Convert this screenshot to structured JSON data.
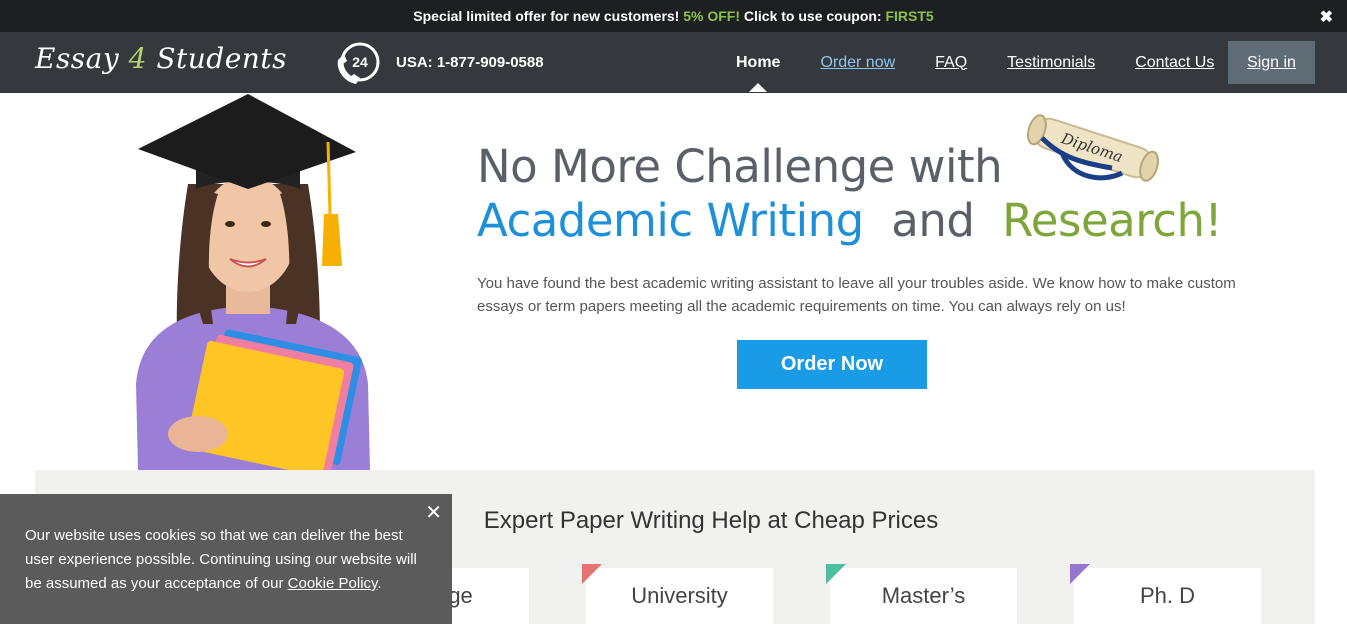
{
  "promo": {
    "text_before": "Special limited offer for new customers! ",
    "discount": "5% OFF!",
    "text_middle": " Click to use coupon: ",
    "coupon": "FIRST5",
    "close": "✖"
  },
  "header": {
    "logo_part1": "Essay ",
    "logo_part2": "4",
    "logo_part3": " Students",
    "phone_badge": "24",
    "phone": "USA: 1-877-909-0588",
    "nav": {
      "home": "Home",
      "order": "Order now",
      "faq": "FAQ",
      "testimonials": "Testimonials",
      "contact": "Contact Us"
    },
    "signin": "Sign in"
  },
  "hero": {
    "title_line1": "No More Challenge with",
    "title_blue": "Academic Writing",
    "title_and": " and ",
    "title_green": "Research!",
    "diploma_label": "Diploma",
    "description": "You have found the best academic writing assistant to leave all your troubles aside. We know how to make custom essays or term papers meeting all the academic requirements on time. You can always rely on us!",
    "order_button": "Order Now"
  },
  "services": {
    "title": "Expert Paper Writing Help at Cheap Prices",
    "levels": [
      {
        "label": "College",
        "corner": "#e6b800"
      },
      {
        "label": "University",
        "corner": "#e57373"
      },
      {
        "label": "Master’s",
        "corner": "#4dbf9f"
      },
      {
        "label": "Ph. D",
        "corner": "#9575cd"
      }
    ]
  },
  "cookie": {
    "text": "Our website uses cookies so that we can deliver the best user experience possible. Continuing using our website will be assumed as your acceptance of our ",
    "link": "Cookie Policy",
    "end": ".",
    "close": "✕"
  },
  "colors": {
    "header_bg": "#35383d",
    "accent_green": "#8bc34a",
    "accent_blue": "#1a9be6"
  }
}
